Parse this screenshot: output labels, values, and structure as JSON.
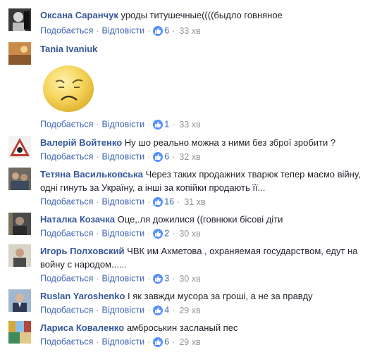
{
  "actions": {
    "like": "Подобається",
    "reply": "Відповісти",
    "dot": "·"
  },
  "colors": {
    "link": "#4267b2",
    "author": "#365899",
    "meta": "#90949c",
    "like_badge": "#5890ff"
  },
  "comments": [
    {
      "author": "Оксана Саранчук",
      "text": "уроды титушечные((((быдло говняное",
      "likes": "6",
      "time": "33 хв",
      "avatar": "bw-portrait"
    },
    {
      "author": "Tania Ivaniuk",
      "text": "",
      "sticker": "sad-face-sticker",
      "likes": "1",
      "time": "33 хв",
      "avatar": "orange-sunset"
    },
    {
      "author": "Валерій Войтенко",
      "text": "Ну шо реально можна з ними без зброї зробити ?",
      "likes": "6",
      "time": "32 хв",
      "avatar": "warning-sign"
    },
    {
      "author": "Тетяна Васильковська",
      "text": "Через таких продажних тварюк тепер маємо війну, одні гинуть за Україну, а інші за копійки продають її...",
      "likes": "16",
      "time": "31 хв",
      "avatar": "group-photo"
    },
    {
      "author": "Наталка Козачка",
      "text": "Оце,.ля дожилися ((говнюки бісові діти",
      "likes": "2",
      "time": "30 хв",
      "avatar": "dark-portrait"
    },
    {
      "author": "Игорь Полховский",
      "text": "ЧВК им Ахметова , охраняемая государством, едут на войну с народом......",
      "likes": "3",
      "time": "30 хв",
      "avatar": "man-portrait"
    },
    {
      "author": "Ruslan Yaroshenko",
      "text": "І як завжди мусора за гроші, а не за правду",
      "likes": "4",
      "time": "29 хв",
      "avatar": "suit-portrait"
    },
    {
      "author": "Лариса Коваленко",
      "text": "амброськин засланый пес",
      "likes": "6",
      "time": "29 хв",
      "avatar": "stained-glass"
    }
  ]
}
